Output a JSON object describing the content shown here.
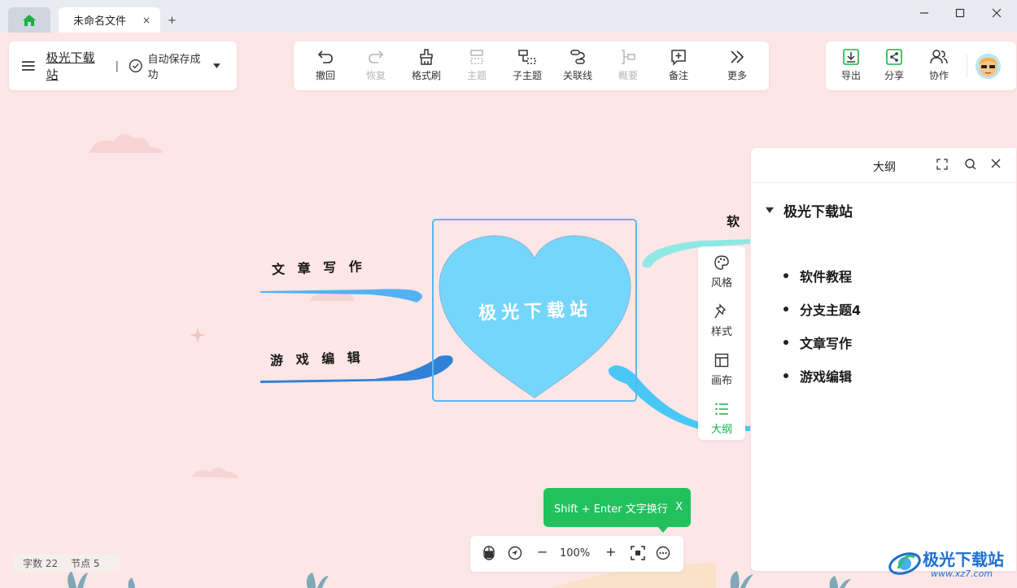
{
  "tabs": {
    "home_icon": "home-icon",
    "active_tab_title": "未命名文件",
    "close_glyph": "×",
    "new_tab_glyph": "+"
  },
  "window_controls": {
    "minimize": "—",
    "maximize": "☐",
    "close": "✕"
  },
  "file_panel": {
    "menu_icon": "hamburger-menu-icon",
    "file_name": "极光下载站",
    "separator": "|",
    "save_status": "自动保存成功"
  },
  "toolbar": {
    "items": [
      {
        "label": "撤回",
        "icon": "undo-icon",
        "enabled": true
      },
      {
        "label": "恢复",
        "icon": "redo-icon",
        "enabled": false
      },
      {
        "label": "格式刷",
        "icon": "format-brush-icon",
        "enabled": true
      },
      {
        "label": "主题",
        "icon": "topic-icon",
        "enabled": false
      },
      {
        "label": "子主题",
        "icon": "subtopic-icon",
        "enabled": true
      },
      {
        "label": "关联线",
        "icon": "relation-line-icon",
        "enabled": true
      },
      {
        "label": "概要",
        "icon": "summary-icon",
        "enabled": false
      },
      {
        "label": "备注",
        "icon": "note-icon",
        "enabled": true
      },
      {
        "label": "更多",
        "icon": "more-icon",
        "enabled": true
      }
    ]
  },
  "right_tools": {
    "export_label": "导出",
    "share_label": "分享",
    "collab_label": "协作",
    "avatar": "user-avatar"
  },
  "mindmap": {
    "center": "极光下载站",
    "branches": {
      "top_right_partial": "软 件",
      "left_top": "文 章 写 作",
      "left_bottom": "游 戏 编 辑"
    },
    "colors": {
      "heart_fill": "#75d6fb",
      "heart_stroke": "#8fb3d9",
      "selection": "#5bb6f0",
      "branch_left_top": "#52b2f5",
      "branch_left_bottom": "#3181d8",
      "branch_top_right": "#8ee9e6",
      "branch_bottom_right": "#49c8f6"
    }
  },
  "side_tabs": [
    {
      "label": "风格",
      "icon": "palette-icon",
      "active": false
    },
    {
      "label": "样式",
      "icon": "style-pin-icon",
      "active": false
    },
    {
      "label": "画布",
      "icon": "canvas-layout-icon",
      "active": false
    },
    {
      "label": "大纲",
      "icon": "outline-list-icon",
      "active": true
    }
  ],
  "outline": {
    "title": "大纲",
    "root": "极光下载站",
    "items": [
      "软件教程",
      "分支主题4",
      "文章写作",
      "游戏编辑"
    ]
  },
  "hint": {
    "text": "Shift + Enter 文字换行",
    "close": "X"
  },
  "zoom": {
    "value": "100%",
    "minus": "−",
    "plus": "+"
  },
  "stats": {
    "words": "字数 22",
    "nodes": "节点 5"
  },
  "watermark": {
    "text": "极光下载站",
    "url": "www.xz7.com"
  },
  "colors": {
    "accent": "#19b34a",
    "canvas_bg": "#fde6e6",
    "arrow": "#f03b2e"
  }
}
